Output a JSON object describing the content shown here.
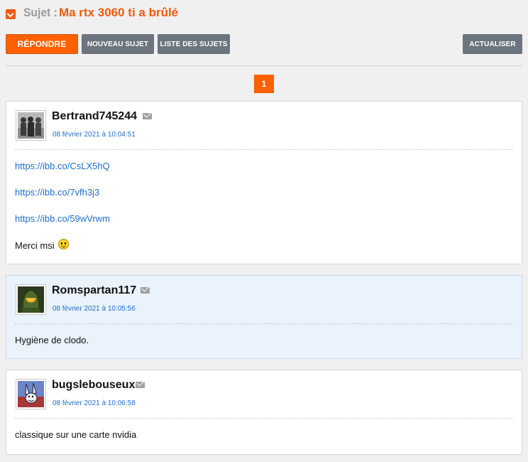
{
  "topic": {
    "label": "Sujet :",
    "title": "Ma rtx 3060 ti a brûlé"
  },
  "toolbar": {
    "reply": "RÉPONDRE",
    "new_topic": "NOUVEAU SUJET",
    "topic_list": "LISTE DES SUJETS",
    "refresh": "ACTUALISER"
  },
  "pagination": {
    "current": "1"
  },
  "colors": {
    "accent": "#ff6000",
    "button_grey": "#6c757d",
    "link": "#1e6ecb",
    "alt_post_bg": "#eaf2fb"
  },
  "posts": [
    {
      "author": "Bertrand745244",
      "date": "08 février 2021 à 10:04:51",
      "avatar_icon": "group-photo-avatar",
      "links": [
        "https://ibb.co/CsLX5hQ",
        "https://ibb.co/7vfh3j3",
        "https://ibb.co/59wVrwm"
      ],
      "text": "Merci msi"
    },
    {
      "author": "Romspartan117",
      "date": "08 février 2021 à 10:05:56",
      "avatar_icon": "spartan-helmet-avatar",
      "text": "Hygiène de clodo."
    },
    {
      "author": "bugslebouseux",
      "date": "08 février 2021 à 10:06:58",
      "avatar_icon": "cartoon-rabbit-avatar",
      "text": "classique sur une carte nvidia"
    }
  ]
}
